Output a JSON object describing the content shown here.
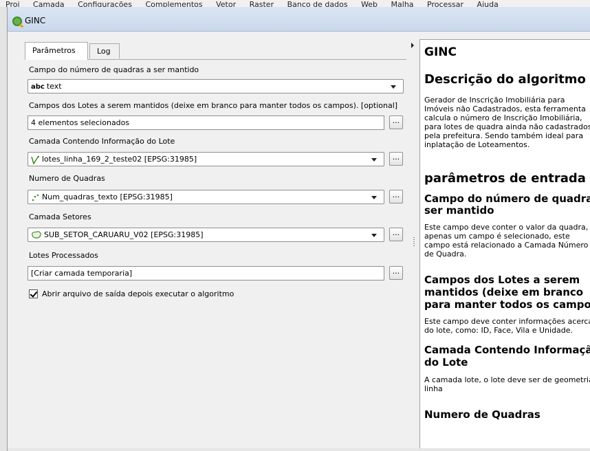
{
  "menubar": {
    "items": [
      "Proj",
      "Camada",
      "Configurações",
      "Complementos",
      "Vetor",
      "Raster",
      "Banco de dados",
      "Web",
      "Malha",
      "Processar",
      "Ajuda"
    ]
  },
  "window": {
    "title": "GINC"
  },
  "tabs": [
    {
      "label": "Parâmetros",
      "active": true
    },
    {
      "label": "Log",
      "active": false
    }
  ],
  "form": {
    "field1": {
      "label": "Campo do número de quadras a ser mantido",
      "type_prefix": "abc",
      "value": "text"
    },
    "field2": {
      "label": "Campos dos Lotes a serem mantidos (deixe em branco para manter todos os campos). [optional]",
      "value": "4 elementos selecionados"
    },
    "field3": {
      "label": "Camada Contendo Informação do Lote",
      "value": "lotes_linha_169_2_teste02 [EPSG:31985]"
    },
    "field4": {
      "label": "Numero de Quadras",
      "value": "Num_quadras_texto [EPSG:31985]"
    },
    "field5": {
      "label": "Camada Setores",
      "value": "SUB_SETOR_CARUARU_V02 [EPSG:31985]"
    },
    "field6": {
      "label": "Lotes Processados",
      "value": "[Criar camada temporaria]"
    },
    "dots_label": "...",
    "open_output_label": "Abrir arquivo de saída depois executar o algoritmo"
  },
  "help": {
    "title": "GINC",
    "description_heading": "Descrição do algoritmo",
    "description_lines": [
      "Gerador de Inscrição Imobiliária para",
      "Imóveis não Cadastrados, esta ferramenta",
      "calcula o número de Inscrição Imobiliária,",
      "para lotes de quadra ainda não cadastrados",
      "pela prefeitura. Sendo também ideal para",
      "inplatação de Loteamentos."
    ],
    "params_heading": "parâmetros de entrada",
    "p1_heading_lines": [
      "Campo do número de quadras a",
      "ser mantido"
    ],
    "p1_text_lines": [
      "Este campo deve conter o valor da quadra, é",
      "apenas um campo é selecionado, este",
      "campo está relacionado a Camada Número",
      "de Quadra."
    ],
    "p2_heading_lines": [
      "Campos dos Lotes a serem",
      "mantidos (deixe em branco",
      "para manter todos os campos)."
    ],
    "p2_text_lines": [
      "Este campo deve conter informações acerca",
      "do lote, como: ID, Face, Vila e Unidade."
    ],
    "p3_heading_lines": [
      "Camada Contendo Informação",
      "do Lote"
    ],
    "p3_text_lines": [
      "A camada lote, o lote deve ser de geometria",
      "linha"
    ],
    "p4_heading": "Numero de Quadras"
  }
}
